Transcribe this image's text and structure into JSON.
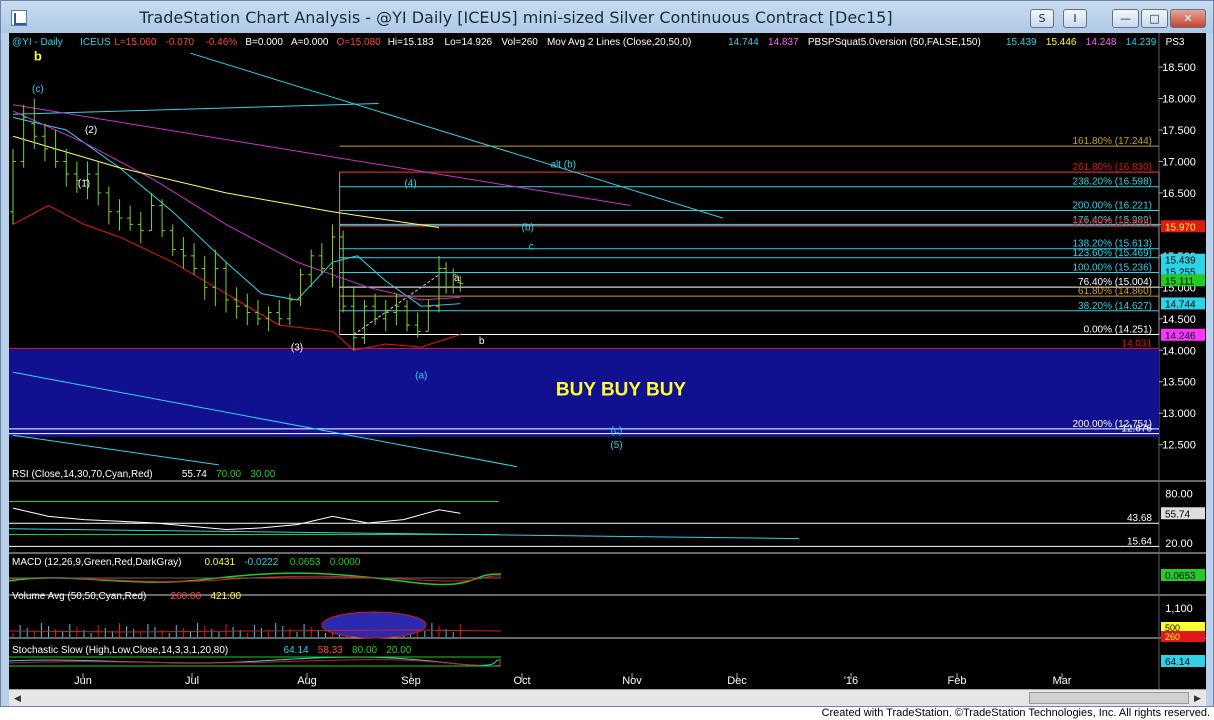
{
  "window": {
    "title": "TradeStation Chart Analysis - @YI Daily [ICEUS] mini-sized Silver Continuous Contract [Dec15]",
    "btn_s": "S",
    "btn_i": "I",
    "btn_min": "—",
    "btn_max": "□",
    "btn_close": "✕"
  },
  "footer": "Created with TradeStation. ©TradeStation Technologies, Inc. All rights reserved.",
  "colors": {
    "background": "#000000",
    "price_bar": "#7fd12e",
    "cyan": "#2fd3e8",
    "red": "#e01818",
    "yellow": "#ffff33",
    "magenta": "#cc33cc",
    "buy_zone": "#101090"
  },
  "chart_data": [
    {
      "type": "bar",
      "panel": "price",
      "header_segments": [
        {
          "text": "@YI - Daily",
          "color": "#2fd3e8"
        },
        {
          "text": "ICEUS",
          "color": "#2fd3e8"
        },
        {
          "text": "L=15.060",
          "color": "#ff4444"
        },
        {
          "text": "-0.070",
          "color": "#ff4444"
        },
        {
          "text": "-0.46%",
          "color": "#ff4444"
        },
        {
          "text": "B=0.000",
          "color": "#ffffff"
        },
        {
          "text": "A=0.000",
          "color": "#ffffff"
        },
        {
          "text": "O=15.080",
          "color": "#ff4444"
        },
        {
          "text": "Hi=15.183",
          "color": "#ffffff"
        },
        {
          "text": "Lo=14.926",
          "color": "#ffffff"
        },
        {
          "text": "Vol=260",
          "color": "#ffffff"
        },
        {
          "text": "Mov Avg 2 Lines (Close,20,50,0)",
          "color": "#ffffff"
        },
        {
          "text": "14.744",
          "color": "#2fd3e8"
        },
        {
          "text": "14.837",
          "color": "#ff66ff"
        },
        {
          "text": "PBSPSquat5.0version (50,FALSE,150)",
          "color": "#ffffff"
        },
        {
          "text": "15.439",
          "color": "#2fd3e8"
        },
        {
          "text": "15.446",
          "color": "#ffff33"
        },
        {
          "text": "14.248",
          "color": "#ff66ff"
        },
        {
          "text": "14.239",
          "color": "#2fd3e8"
        },
        {
          "text": "PS3",
          "color": "#ffffff"
        }
      ],
      "x_ticks": [
        "Jun",
        "Jul",
        "Aug",
        "Sep",
        "Oct",
        "Nov",
        "Dec",
        "'16",
        "Feb",
        "Mar"
      ],
      "y_ticks": [
        "18.500",
        "18.000",
        "17.500",
        "17.000",
        "16.500",
        "16.000",
        "15.500",
        "15.000",
        "14.500",
        "14.000",
        "13.500",
        "13.000",
        "12.500"
      ],
      "ylim": [
        12.05,
        18.85
      ],
      "bars": [
        {
          "day": 0,
          "o": 16.2,
          "h": 17.2,
          "l": 16.0,
          "c": 17.0
        },
        {
          "day": 3,
          "o": 17.0,
          "h": 17.9,
          "l": 16.9,
          "c": 17.7
        },
        {
          "day": 6,
          "o": 17.6,
          "h": 18.0,
          "l": 17.2,
          "c": 17.4
        },
        {
          "day": 9,
          "o": 17.4,
          "h": 17.6,
          "l": 17.0,
          "c": 17.2
        },
        {
          "day": 12,
          "o": 17.2,
          "h": 17.5,
          "l": 16.9,
          "c": 17.0
        },
        {
          "day": 15,
          "o": 17.0,
          "h": 17.2,
          "l": 16.6,
          "c": 16.8
        },
        {
          "day": 18,
          "o": 16.8,
          "h": 17.0,
          "l": 16.5,
          "c": 16.7
        },
        {
          "day": 21,
          "o": 16.7,
          "h": 17.0,
          "l": 16.4,
          "c": 16.8
        },
        {
          "day": 24,
          "o": 16.8,
          "h": 17.0,
          "l": 16.3,
          "c": 16.5
        },
        {
          "day": 27,
          "o": 16.5,
          "h": 16.6,
          "l": 16.0,
          "c": 16.2
        },
        {
          "day": 30,
          "o": 16.2,
          "h": 16.4,
          "l": 15.9,
          "c": 16.1
        },
        {
          "day": 33,
          "o": 16.1,
          "h": 16.3,
          "l": 15.9,
          "c": 16.0
        },
        {
          "day": 36,
          "o": 16.0,
          "h": 16.2,
          "l": 15.7,
          "c": 15.9
        },
        {
          "day": 39,
          "o": 15.9,
          "h": 16.5,
          "l": 15.9,
          "c": 16.3
        },
        {
          "day": 42,
          "o": 16.3,
          "h": 16.4,
          "l": 15.8,
          "c": 15.9
        },
        {
          "day": 45,
          "o": 15.9,
          "h": 16.0,
          "l": 15.5,
          "c": 15.6
        },
        {
          "day": 48,
          "o": 15.6,
          "h": 15.8,
          "l": 15.3,
          "c": 15.5
        },
        {
          "day": 51,
          "o": 15.5,
          "h": 15.7,
          "l": 15.2,
          "c": 15.3
        },
        {
          "day": 54,
          "o": 15.3,
          "h": 15.5,
          "l": 14.8,
          "c": 15.0
        },
        {
          "day": 57,
          "o": 15.0,
          "h": 15.6,
          "l": 14.7,
          "c": 15.3
        },
        {
          "day": 60,
          "o": 15.3,
          "h": 15.4,
          "l": 14.6,
          "c": 14.8
        },
        {
          "day": 63,
          "o": 14.8,
          "h": 15.0,
          "l": 14.5,
          "c": 14.7
        },
        {
          "day": 66,
          "o": 14.7,
          "h": 14.9,
          "l": 14.4,
          "c": 14.6
        },
        {
          "day": 69,
          "o": 14.6,
          "h": 14.8,
          "l": 14.4,
          "c": 14.5
        },
        {
          "day": 72,
          "o": 14.5,
          "h": 14.7,
          "l": 14.3,
          "c": 14.6
        },
        {
          "day": 75,
          "o": 14.6,
          "h": 14.8,
          "l": 14.4,
          "c": 14.5
        },
        {
          "day": 78,
          "o": 14.5,
          "h": 14.9,
          "l": 14.4,
          "c": 14.8
        },
        {
          "day": 81,
          "o": 14.8,
          "h": 15.3,
          "l": 14.7,
          "c": 15.2
        },
        {
          "day": 84,
          "o": 15.2,
          "h": 15.6,
          "l": 15.0,
          "c": 15.5
        },
        {
          "day": 87,
          "o": 15.5,
          "h": 15.7,
          "l": 15.2,
          "c": 15.3
        },
        {
          "day": 90,
          "o": 15.3,
          "h": 16.0,
          "l": 15.0,
          "c": 15.8
        },
        {
          "day": 93,
          "o": 15.8,
          "h": 15.9,
          "l": 14.6,
          "c": 14.7
        },
        {
          "day": 96,
          "o": 14.7,
          "h": 15.0,
          "l": 14.0,
          "c": 14.2
        },
        {
          "day": 99,
          "o": 14.2,
          "h": 14.8,
          "l": 14.1,
          "c": 14.7
        },
        {
          "day": 102,
          "o": 14.7,
          "h": 14.9,
          "l": 14.4,
          "c": 14.5
        },
        {
          "day": 105,
          "o": 14.5,
          "h": 14.8,
          "l": 14.3,
          "c": 14.6
        },
        {
          "day": 108,
          "o": 14.6,
          "h": 14.9,
          "l": 14.4,
          "c": 14.7
        },
        {
          "day": 111,
          "o": 14.7,
          "h": 14.8,
          "l": 14.3,
          "c": 14.4
        },
        {
          "day": 114,
          "o": 14.4,
          "h": 14.6,
          "l": 14.2,
          "c": 14.3
        },
        {
          "day": 117,
          "o": 14.3,
          "h": 14.8,
          "l": 14.3,
          "c": 14.7
        },
        {
          "day": 120,
          "o": 14.7,
          "h": 15.5,
          "l": 14.6,
          "c": 15.3
        },
        {
          "day": 122,
          "o": 15.3,
          "h": 15.4,
          "l": 14.9,
          "c": 15.0
        },
        {
          "day": 124,
          "o": 15.0,
          "h": 15.3,
          "l": 14.9,
          "c": 15.2
        },
        {
          "day": 126,
          "o": 15.08,
          "h": 15.18,
          "l": 14.93,
          "c": 15.06
        }
      ],
      "series": [
        {
          "name": "Mov Avg 2 Lines (Close,20,50,0)",
          "color": "#2fd3e8",
          "x": [
            0,
            15,
            30,
            45,
            60,
            70,
            80,
            90,
            97,
            105,
            115,
            126
          ],
          "values": [
            17.7,
            17.5,
            16.9,
            16.2,
            15.4,
            14.9,
            14.8,
            15.4,
            15.5,
            15.1,
            14.7,
            14.74
          ]
        },
        {
          "name": "",
          "color": "#cc33cc",
          "x": [
            0,
            20,
            40,
            60,
            80,
            100,
            115,
            126
          ],
          "values": [
            17.8,
            17.3,
            16.7,
            16.0,
            15.4,
            15.0,
            14.8,
            14.84
          ]
        },
        {
          "name": "",
          "color": "#e01818",
          "x": [
            0,
            10,
            20,
            30,
            45,
            60,
            75,
            90,
            96,
            105,
            115,
            126
          ],
          "values": [
            16.0,
            16.3,
            16.0,
            15.8,
            15.4,
            14.9,
            14.4,
            14.3,
            14.0,
            14.1,
            14.05,
            14.25
          ]
        },
        {
          "name": "",
          "color": "#ffff66",
          "x": [
            0,
            30,
            60,
            90,
            120
          ],
          "values": [
            17.4,
            16.9,
            16.5,
            16.2,
            15.95
          ]
        }
      ],
      "trendlines": [
        {
          "color": "#2fd3e8",
          "x": [
            50,
            200
          ],
          "values": [
            18.72,
            16.1
          ]
        },
        {
          "color": "#2fd3e8",
          "x": [
            0,
            103
          ],
          "values": [
            17.75,
            17.92
          ]
        },
        {
          "color": "#cc33cc",
          "x": [
            0,
            174
          ],
          "values": [
            17.9,
            16.3
          ]
        },
        {
          "color": "#2fd3e8",
          "x": [
            0,
            142
          ],
          "values": [
            13.65,
            12.15
          ]
        },
        {
          "color": "#2fd3e8",
          "x": [
            0,
            58
          ],
          "values": [
            12.65,
            12.18
          ]
        }
      ],
      "horizontal_lines": [
        {
          "value": 17.244,
          "color": "#c8a028",
          "label": "161.80% (17.244)"
        },
        {
          "value": 16.83,
          "color": "#e01818",
          "label": "261.80% (16.830)"
        },
        {
          "value": 16.598,
          "color": "#2fd3e8",
          "label": "238.20% (16.598)"
        },
        {
          "value": 16.221,
          "color": "#2fd3e8",
          "label": "200.00% (16.221)"
        },
        {
          "value": 15.989,
          "color": "#2fd3e8",
          "label": "176.40% (15.989)"
        },
        {
          "value": 15.97,
          "color": "#e01818",
          "label": "161.80% (15.845)"
        },
        {
          "value": 15.613,
          "color": "#2fd3e8",
          "label": "138.20% (15.613)"
        },
        {
          "value": 15.469,
          "color": "#2fd3e8",
          "label": "123.60% (15.469)"
        },
        {
          "value": 15.236,
          "color": "#2fd3e8",
          "label": "100.00% (15.236)"
        },
        {
          "value": 15.004,
          "color": "#ffffff",
          "label": "76.40% (15.004)"
        },
        {
          "value": 14.86,
          "color": "#c8a028",
          "label": "61.80% (14.860)"
        },
        {
          "value": 14.627,
          "color": "#2fd3e8",
          "label": "38.20% (14.627)"
        },
        {
          "value": 14.251,
          "color": "#ffffff",
          "label": "0.00% (14.251)"
        },
        {
          "value": 14.031,
          "color": "#e01818",
          "label": "14.031"
        },
        {
          "value": 12.751,
          "color": "#ffffff",
          "label": "200.00% (12.751)"
        },
        {
          "value": 12.676,
          "color": "#ffffff",
          "label": "12.676"
        }
      ],
      "buy_zone": {
        "top": 14.03,
        "bottom": 12.62,
        "label": "BUY BUY BUY"
      },
      "wave_labels": [
        {
          "text": "b",
          "day": 7,
          "value": 18.6,
          "color": "#ffff33"
        },
        {
          "text": "(c)",
          "day": 7,
          "value": 18.1,
          "color": "#2fd3e8"
        },
        {
          "text": "(2)",
          "day": 22,
          "value": 17.45,
          "color": "#ffffff"
        },
        {
          "text": "(1)",
          "day": 20,
          "value": 16.6,
          "color": "#ffffff"
        },
        {
          "text": "(3)",
          "day": 80,
          "value": 14.0,
          "color": "#ffffff"
        },
        {
          "text": "(4)",
          "day": 112,
          "value": 16.6,
          "color": "#2fd3e8"
        },
        {
          "text": "(a)",
          "day": 115,
          "value": 13.55,
          "color": "#2fd3e8"
        },
        {
          "text": "a",
          "day": 125,
          "value": 15.1,
          "color": "#ffffff"
        },
        {
          "text": "b",
          "day": 132,
          "value": 14.1,
          "color": "#ffffff"
        },
        {
          "text": "(b)",
          "day": 145,
          "value": 15.9,
          "color": "#2fd3e8"
        },
        {
          "text": "c",
          "day": 146,
          "value": 15.6,
          "color": "#2fd3e8"
        },
        {
          "text": "alt (b)",
          "day": 155,
          "value": 16.9,
          "color": "#2fd3e8"
        },
        {
          "text": "(c)",
          "day": 170,
          "value": 12.68,
          "color": "#2fd3e8"
        },
        {
          "text": "(5)",
          "day": 170,
          "value": 12.45,
          "color": "#2fd3e8"
        }
      ],
      "price_tags": [
        {
          "value": 15.97,
          "text": "15.970",
          "bg": "#e01818",
          "fg": "#ffff33"
        },
        {
          "value": 15.439,
          "text": "15.439",
          "bg": "#2fd3e8",
          "fg": "#000000"
        },
        {
          "value": 15.255,
          "text": "15.255",
          "bg": "#2fd3e8",
          "fg": "#000000"
        },
        {
          "value": 15.111,
          "text": "15.111",
          "bg": "#22cc22",
          "fg": "#000000"
        },
        {
          "value": 14.744,
          "text": "14.744",
          "bg": "#2fd3e8",
          "fg": "#000000"
        },
        {
          "value": 14.246,
          "text": "14.246",
          "bg": "#ff33ff",
          "fg": "#000000"
        }
      ]
    },
    {
      "type": "line",
      "panel": "rsi",
      "header_segments": [
        {
          "text": "RSI (Close,14,30,70,Cyan,Red)",
          "color": "#ffffff"
        },
        {
          "text": "55.74",
          "color": "#ffffff"
        },
        {
          "text": "70.00",
          "color": "#22cc22"
        },
        {
          "text": "30.00",
          "color": "#22cc22"
        }
      ],
      "y_ticks": [
        "80.00",
        "20.00"
      ],
      "ylim": [
        10,
        90
      ],
      "x": [
        0,
        10,
        20,
        30,
        40,
        50,
        60,
        70,
        80,
        90,
        100,
        110,
        120,
        126
      ],
      "values": [
        62,
        52,
        48,
        46,
        44,
        40,
        36,
        38,
        42,
        52,
        44,
        48,
        60,
        55.74
      ],
      "hlines": [
        {
          "value": 43.68,
          "label": "43.68"
        },
        {
          "value": 15.64,
          "label": "15.64"
        }
      ],
      "last_tag": "55.74"
    },
    {
      "type": "line",
      "panel": "macd",
      "header_segments": [
        {
          "text": "MACD (12,26,9,Green,Red,DarkGray)",
          "color": "#ffffff"
        },
        {
          "text": "0.0431",
          "color": "#ffff33"
        },
        {
          "text": "-0.0222",
          "color": "#2fd3e8"
        },
        {
          "text": "0.0653",
          "color": "#22cc22"
        },
        {
          "text": "0.0000",
          "color": "#22cc22"
        }
      ],
      "last_tag": "0.0653"
    },
    {
      "type": "bar",
      "panel": "volume",
      "header_segments": [
        {
          "text": "Volume Avg (50,50,Cyan,Red)",
          "color": "#ffffff"
        },
        {
          "text": "260.00",
          "color": "#ff4444"
        },
        {
          "text": "421.00",
          "color": "#ffff33"
        }
      ],
      "y_ticks": [
        "1,100"
      ],
      "last_tag": "260",
      "ellipse_tag": "500"
    },
    {
      "type": "line",
      "panel": "stochastic",
      "header_segments": [
        {
          "text": "Stochastic Slow (High,Low,Close,14,3,3,1,20,80)",
          "color": "#ffffff"
        },
        {
          "text": "64.14",
          "color": "#2fd3e8"
        },
        {
          "text": "58.33",
          "color": "#ff4444"
        },
        {
          "text": "80.00",
          "color": "#22cc22"
        },
        {
          "text": "20.00",
          "color": "#22cc22"
        }
      ],
      "last_tag": "64.14"
    }
  ]
}
